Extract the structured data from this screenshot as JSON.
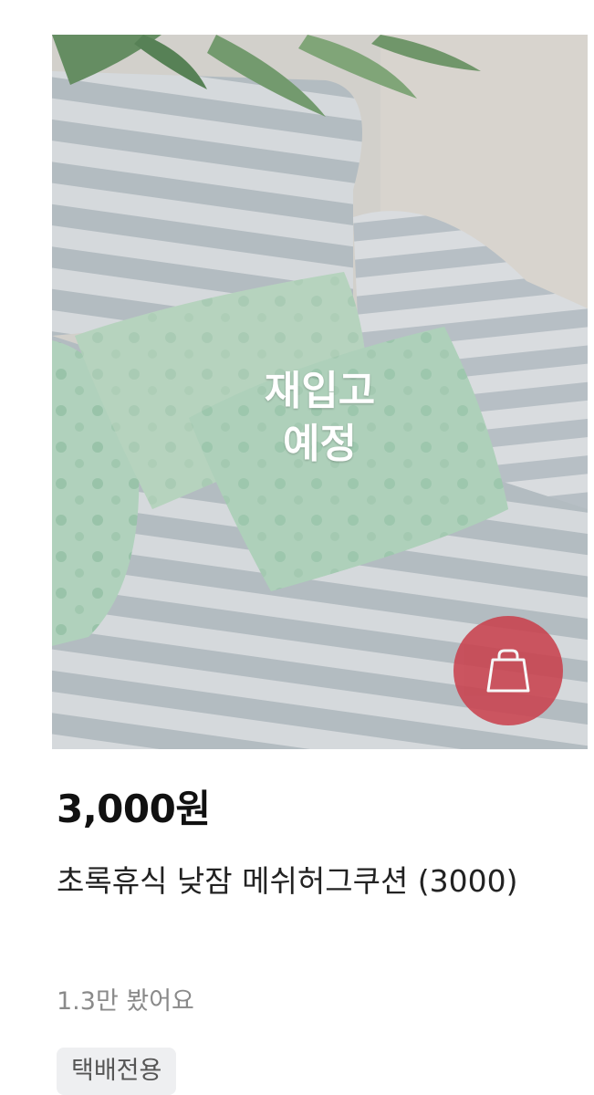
{
  "product": {
    "overlay_line1": "재입고",
    "overlay_line2": "예정",
    "price": "3,000원",
    "title": "초록휴식 낮잠 메쉬허그쿠션 (3000)",
    "views": "1.3만 봤어요",
    "badge": "택배전용",
    "image_icon": "product-photo",
    "cart_icon": "shopping-bag-icon"
  },
  "colors": {
    "cart_button": "#c9424e",
    "price_text": "#111111",
    "views_text": "#8a8a8a",
    "badge_bg": "#eeeff1"
  }
}
